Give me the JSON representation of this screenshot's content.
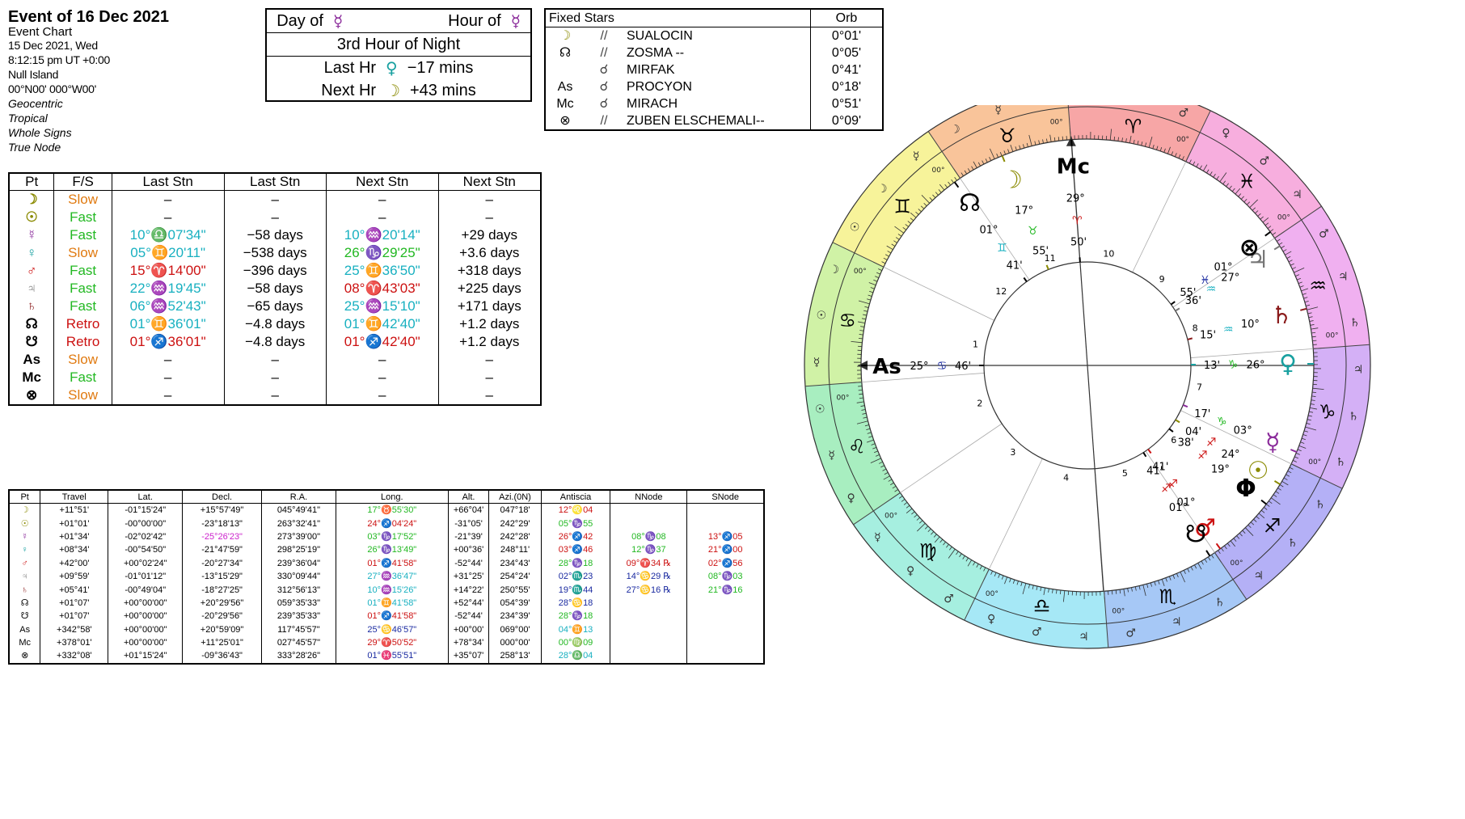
{
  "header": {
    "title": "Event of 16 Dec 2021",
    "subtitle": "Event Chart",
    "date": "15 Dec 2021, Wed",
    "time": "8:12:15 pm  UT +0:00",
    "place": "Null Island",
    "coords": "00°N00' 000°W00'",
    "options": [
      "Geocentric",
      "Tropical",
      "Whole Signs",
      "True Node"
    ]
  },
  "hour_box": {
    "day_label": "Day of",
    "day_glyph": "☿",
    "hour_label": "Hour of",
    "hour_glyph": "☿",
    "hour_of_night": "3rd Hour of Night",
    "last_label": "Last Hr",
    "last_glyph": "♀",
    "last_value": "−17 mins",
    "next_label": "Next Hr",
    "next_glyph": "☽",
    "next_value": "+43 mins"
  },
  "fixed_stars": {
    "header_name": "Fixed Stars",
    "header_orb": "Orb",
    "rows": [
      {
        "p": "☽",
        "pc": "#8a8a00",
        "a": "//",
        "n": "SUALOCIN",
        "o": "0°01'"
      },
      {
        "p": "☊",
        "pc": "#000",
        "a": "//",
        "n": "ZOSMA --",
        "o": "0°05'"
      },
      {
        "p": "",
        "pc": "#000",
        "a": "☌",
        "n": "MIRFAK",
        "o": "0°41'"
      },
      {
        "p": "As",
        "pc": "#000",
        "a": "☌",
        "n": "PROCYON",
        "o": "0°18'"
      },
      {
        "p": "Mc",
        "pc": "#000",
        "a": "☌",
        "n": "MIRACH",
        "o": "0°51'"
      },
      {
        "p": "⊗",
        "pc": "#000",
        "a": "//",
        "n": "ZUBEN ELSCHEMALI--",
        "o": "0°09'"
      }
    ]
  },
  "stations": {
    "headers": [
      "Pt",
      "F/S",
      "Last Stn",
      "Last Stn",
      "Next Stn",
      "Next Stn"
    ],
    "rows": [
      {
        "g": "☽",
        "gc": "#8a8a00",
        "fs": "Slow",
        "fc": "#e07a10",
        "l1": "–",
        "l1c": "#000",
        "l2": "–",
        "n1": "–",
        "n1c": "#000",
        "n2": "–"
      },
      {
        "g": "☉",
        "gc": "#8a8a00",
        "fs": "Fast",
        "fc": "#22b822",
        "l1": "–",
        "l1c": "#000",
        "l2": "–",
        "n1": "–",
        "n1c": "#000",
        "n2": "–"
      },
      {
        "g": "☿",
        "gc": "#8a2a9a",
        "fs": "Fast",
        "fc": "#22b822",
        "l1": "10°♎07'34\"",
        "l1c": "#18b0c0",
        "l2": "−58 days",
        "n1": "10°♒20'14\"",
        "n1c": "#18b0c0",
        "n2": "+29 days"
      },
      {
        "g": "♀",
        "gc": "#18a0a0",
        "fs": "Slow",
        "fc": "#e07a10",
        "l1": "05°♊20'11\"",
        "l1c": "#18b0c0",
        "l2": "−538 days",
        "n1": "26°♑29'25\"",
        "n1c": "#22b822",
        "n2": "+3.6 days"
      },
      {
        "g": "♂",
        "gc": "#cc1111",
        "fs": "Fast",
        "fc": "#22b822",
        "l1": "15°♈14'00\"",
        "l1c": "#cc1111",
        "l2": "−396 days",
        "n1": "25°♊36'50\"",
        "n1c": "#18b0c0",
        "n2": "+318 days"
      },
      {
        "g": "♃",
        "gc": "#777",
        "fs": "Fast",
        "fc": "#22b822",
        "l1": "22°♒19'45\"",
        "l1c": "#18b0c0",
        "l2": "−58 days",
        "n1": "08°♈43'03\"",
        "n1c": "#cc1111",
        "n2": "+225 days"
      },
      {
        "g": "♄",
        "gc": "#8a1a1a",
        "fs": "Fast",
        "fc": "#22b822",
        "l1": "06°♒52'43\"",
        "l1c": "#18b0c0",
        "l2": "−65 days",
        "n1": "25°♒15'10\"",
        "n1c": "#18b0c0",
        "n2": "+171 days"
      },
      {
        "g": "☊",
        "gc": "#000",
        "fs": "Retro",
        "fc": "#cc1111",
        "l1": "01°♊36'01\"",
        "l1c": "#18b0c0",
        "l2": "−4.8 days",
        "n1": "01°♊42'40\"",
        "n1c": "#18b0c0",
        "n2": "+1.2 days"
      },
      {
        "g": "☋",
        "gc": "#000",
        "fs": "Retro",
        "fc": "#cc1111",
        "l1": "01°♐36'01\"",
        "l1c": "#cc1111",
        "l2": "−4.8 days",
        "n1": "01°♐42'40\"",
        "n1c": "#cc1111",
        "n2": "+1.2 days"
      },
      {
        "g": "As",
        "gc": "#000",
        "fs": "Slow",
        "fc": "#e07a10",
        "l1": "–",
        "l1c": "#000",
        "l2": "–",
        "n1": "–",
        "n1c": "#000",
        "n2": "–"
      },
      {
        "g": "Mc",
        "gc": "#000",
        "fs": "Fast",
        "fc": "#22b822",
        "l1": "–",
        "l1c": "#000",
        "l2": "–",
        "n1": "–",
        "n1c": "#000",
        "n2": "–"
      },
      {
        "g": "⊗",
        "gc": "#000",
        "fs": "Slow",
        "fc": "#e07a10",
        "l1": "–",
        "l1c": "#000",
        "l2": "–",
        "n1": "–",
        "n1c": "#000",
        "n2": "–"
      }
    ]
  },
  "positions": {
    "headers": [
      "Pt",
      "Travel",
      "Lat.",
      "Decl.",
      "R.A.",
      "Long.",
      "Alt.",
      "Azi.(0N)",
      "Antiscia",
      "NNode",
      "SNode"
    ],
    "rows": [
      {
        "g": "☽",
        "gc": "#8a8a00",
        "tr": "+11°51'",
        "lat": "-01°15'24\"",
        "dec": "+15°57'49\"",
        "dc": "#000",
        "ra": "045°49'41\"",
        "lo": "17°♉55'30\"",
        "lc": "#22b822",
        "alt": "+66°04'",
        "az": "047°18'",
        "an": "12°♌04",
        "ac": "#cc1111",
        "nn": "",
        "nc": "#000",
        "sn": "",
        "sc": "#000"
      },
      {
        "g": "☉",
        "gc": "#8a8a00",
        "tr": "+01°01'",
        "lat": "-00°00'00\"",
        "dec": "-23°18'13\"",
        "dc": "#000",
        "ra": "263°32'41\"",
        "lo": "24°♐04'24\"",
        "lc": "#cc1111",
        "alt": "-31°05'",
        "az": "242°29'",
        "an": "05°♑55",
        "ac": "#22b822",
        "nn": "",
        "nc": "#000",
        "sn": "",
        "sc": "#000"
      },
      {
        "g": "☿",
        "gc": "#8a2a9a",
        "tr": "+01°34'",
        "lat": "-02°02'42\"",
        "dec": "-25°26'23\"",
        "dc": "#cc22cc",
        "ra": "273°39'00\"",
        "lo": "03°♑17'52\"",
        "lc": "#22b822",
        "alt": "-21°39'",
        "az": "242°28'",
        "an": "26°♐42",
        "ac": "#cc1111",
        "nn": "08°♑08",
        "nc": "#22b822",
        "sn": "13°♐05",
        "sc": "#cc1111"
      },
      {
        "g": "♀",
        "gc": "#18a0a0",
        "tr": "+08°34'",
        "lat": "-00°54'50\"",
        "dec": "-21°47'59\"",
        "dc": "#000",
        "ra": "298°25'19\"",
        "lo": "26°♑13'49\"",
        "lc": "#22b822",
        "alt": "+00°36'",
        "az": "248°11'",
        "an": "03°♐46",
        "ac": "#cc1111",
        "nn": "12°♑37",
        "nc": "#22b822",
        "sn": "21°♐00",
        "sc": "#cc1111"
      },
      {
        "g": "♂",
        "gc": "#cc1111",
        "tr": "+42°00'",
        "lat": "+00°02'24\"",
        "dec": "-20°27'34\"",
        "dc": "#000",
        "ra": "239°36'04\"",
        "lo": "01°♐41'58\"",
        "lc": "#cc1111",
        "alt": "-52°44'",
        "az": "234°43'",
        "an": "28°♑18",
        "ac": "#22b822",
        "nn": "09°♈34 ℞",
        "nc": "#cc1111",
        "sn": "02°♐56",
        "sc": "#cc1111"
      },
      {
        "g": "♃",
        "gc": "#777",
        "tr": "+09°59'",
        "lat": "-01°01'12\"",
        "dec": "-13°15'29\"",
        "dc": "#000",
        "ra": "330°09'44\"",
        "lo": "27°♒36'47\"",
        "lc": "#18b0c0",
        "alt": "+31°25'",
        "az": "254°24'",
        "an": "02°♏23",
        "ac": "#1a2aa0",
        "nn": "14°♋29 ℞",
        "nc": "#1a2aa0",
        "sn": "08°♑03",
        "sc": "#22b822"
      },
      {
        "g": "♄",
        "gc": "#8a1a1a",
        "tr": "+05°41'",
        "lat": "-00°49'04\"",
        "dec": "-18°27'25\"",
        "dc": "#000",
        "ra": "312°56'13\"",
        "lo": "10°♒15'26\"",
        "lc": "#18b0c0",
        "alt": "+14°22'",
        "az": "250°55'",
        "an": "19°♏44",
        "ac": "#1a2aa0",
        "nn": "27°♋16 ℞",
        "nc": "#1a2aa0",
        "sn": "21°♑16",
        "sc": "#22b822"
      },
      {
        "g": "☊",
        "gc": "#000",
        "tr": "+01°07'",
        "lat": "+00°00'00\"",
        "dec": "+20°29'56\"",
        "dc": "#000",
        "ra": "059°35'33\"",
        "lo": "01°♊41'58\"",
        "lc": "#18b0c0",
        "alt": "+52°44'",
        "az": "054°39'",
        "an": "28°♋18",
        "ac": "#1a2aa0",
        "nn": "",
        "nc": "#000",
        "sn": "",
        "sc": "#000"
      },
      {
        "g": "☋",
        "gc": "#000",
        "tr": "+01°07'",
        "lat": "+00°00'00\"",
        "dec": "-20°29'56\"",
        "dc": "#000",
        "ra": "239°35'33\"",
        "lo": "01°♐41'58\"",
        "lc": "#cc1111",
        "alt": "-52°44'",
        "az": "234°39'",
        "an": "28°♑18",
        "ac": "#22b822",
        "nn": "",
        "nc": "#000",
        "sn": "",
        "sc": "#000"
      },
      {
        "g": "As",
        "gc": "#000",
        "tr": "+342°58'",
        "lat": "+00°00'00\"",
        "dec": "+20°59'09\"",
        "dc": "#000",
        "ra": "117°45'57\"",
        "lo": "25°♋46'57\"",
        "lc": "#1a2aa0",
        "alt": "+00°00'",
        "az": "069°00'",
        "an": "04°♊13",
        "ac": "#18b0c0",
        "nn": "",
        "nc": "#000",
        "sn": "",
        "sc": "#000"
      },
      {
        "g": "Mc",
        "gc": "#000",
        "tr": "+378°01'",
        "lat": "+00°00'00\"",
        "dec": "+11°25'01\"",
        "dc": "#000",
        "ra": "027°45'57\"",
        "lo": "29°♈50'52\"",
        "lc": "#cc1111",
        "alt": "+78°34'",
        "az": "000°00'",
        "an": "00°♍09",
        "ac": "#22b822",
        "nn": "",
        "nc": "#000",
        "sn": "",
        "sc": "#000"
      },
      {
        "g": "⊗",
        "gc": "#000",
        "tr": "+332°08'",
        "lat": "+01°15'24\"",
        "dec": "-09°36'43\"",
        "dc": "#000",
        "ra": "333°28'26\"",
        "lo": "01°♓55'51\"",
        "lc": "#1a2aa0",
        "alt": "+35°07'",
        "az": "258°13'",
        "an": "28°♎04",
        "ac": "#18b0c0",
        "nn": "",
        "nc": "#000",
        "sn": "",
        "sc": "#000"
      }
    ]
  },
  "wheel": {
    "signs": [
      {
        "g": "♈",
        "c": "#f7a6a6",
        "lon": 0
      },
      {
        "g": "♉",
        "c": "#f9c49a",
        "lon": 30
      },
      {
        "g": "♊",
        "c": "#f7f39a",
        "lon": 60
      },
      {
        "g": "♋",
        "c": "#d0f2a6",
        "lon": 90
      },
      {
        "g": "♌",
        "c": "#a8eec0",
        "lon": 120
      },
      {
        "g": "♍",
        "c": "#a6efe0",
        "lon": 150
      },
      {
        "g": "♎",
        "c": "#a6e8f6",
        "lon": 180
      },
      {
        "g": "♏",
        "c": "#a6c8f6",
        "lon": 210
      },
      {
        "g": "♐",
        "c": "#b4b0f6",
        "lon": 240
      },
      {
        "g": "♑",
        "c": "#d4b0f6",
        "lon": 270
      },
      {
        "g": "♒",
        "c": "#f0b0f0",
        "lon": 300
      },
      {
        "g": "♓",
        "c": "#f7aede",
        "lon": 330
      }
    ],
    "asc_lon": 115.78,
    "houses": [
      "1",
      "2",
      "3",
      "4",
      "5",
      "6",
      "7",
      "8",
      "9",
      "10",
      "11",
      "12"
    ],
    "zero_label": "00°",
    "planets": [
      {
        "g": "☽",
        "c": "#8a8a00",
        "lon": 47.9,
        "deg": "17°",
        "sg": "♉",
        "sc": "#22b822",
        "min": "55'"
      },
      {
        "g": "☿",
        "c": "#8a2a9a",
        "lon": 273.3,
        "deg": "03°",
        "sg": "♑",
        "sc": "#22b822",
        "min": "17'"
      },
      {
        "g": "☉",
        "c": "#8a8a00",
        "lon": 264.1,
        "deg": "24°",
        "sg": "♐",
        "sc": "#cc1111",
        "min": "04'"
      },
      {
        "g": "Φ",
        "c": "#000",
        "lon": 258.0,
        "deg": "19°",
        "sg": "♐",
        "sc": "#cc1111",
        "min": "38'"
      },
      {
        "g": "♂",
        "c": "#cc1111",
        "lon": 241.7,
        "deg": "01°",
        "sg": "♐",
        "sc": "#cc1111",
        "min": "41'"
      },
      {
        "g": "☋",
        "c": "#000",
        "lon": 238.5,
        "deg": "01°",
        "sg": "♐",
        "sc": "#cc1111",
        "min": "41'"
      },
      {
        "g": "♀",
        "c": "#18a0a0",
        "lon": 296.2,
        "deg": "26°",
        "sg": "♑",
        "sc": "#22b822",
        "min": "13'"
      },
      {
        "g": "♄",
        "c": "#8a1a1a",
        "lon": 310.3,
        "deg": "10°",
        "sg": "♒",
        "sc": "#18b0c0",
        "min": "15'"
      },
      {
        "g": "♃",
        "c": "#777",
        "lon": 327.6,
        "deg": "27°",
        "sg": "♒",
        "sc": "#18b0c0",
        "min": "36'"
      },
      {
        "g": "⊗",
        "c": "#000",
        "lon": 331.9,
        "deg": "01°",
        "sg": "♓",
        "sc": "#1a2aa0",
        "min": "55'"
      },
      {
        "g": "☊",
        "c": "#000",
        "lon": 61.7,
        "deg": "01°",
        "sg": "♊",
        "sc": "#18b0c0",
        "min": "41'"
      },
      {
        "g": "As",
        "c": "#000",
        "lon": 115.78,
        "deg": "25°",
        "sg": "♋",
        "sc": "#1a2aa0",
        "min": "46'"
      },
      {
        "g": "Mc",
        "c": "#000",
        "lon": 29.85,
        "deg": "29°",
        "sg": "♈",
        "sc": "#cc1111",
        "min": "50'"
      }
    ],
    "rulers": [
      "♂",
      "♀",
      "☿",
      "☽",
      "☉",
      "☿",
      "♀",
      "♂",
      "♃",
      "♄",
      "♄",
      "♃"
    ]
  }
}
